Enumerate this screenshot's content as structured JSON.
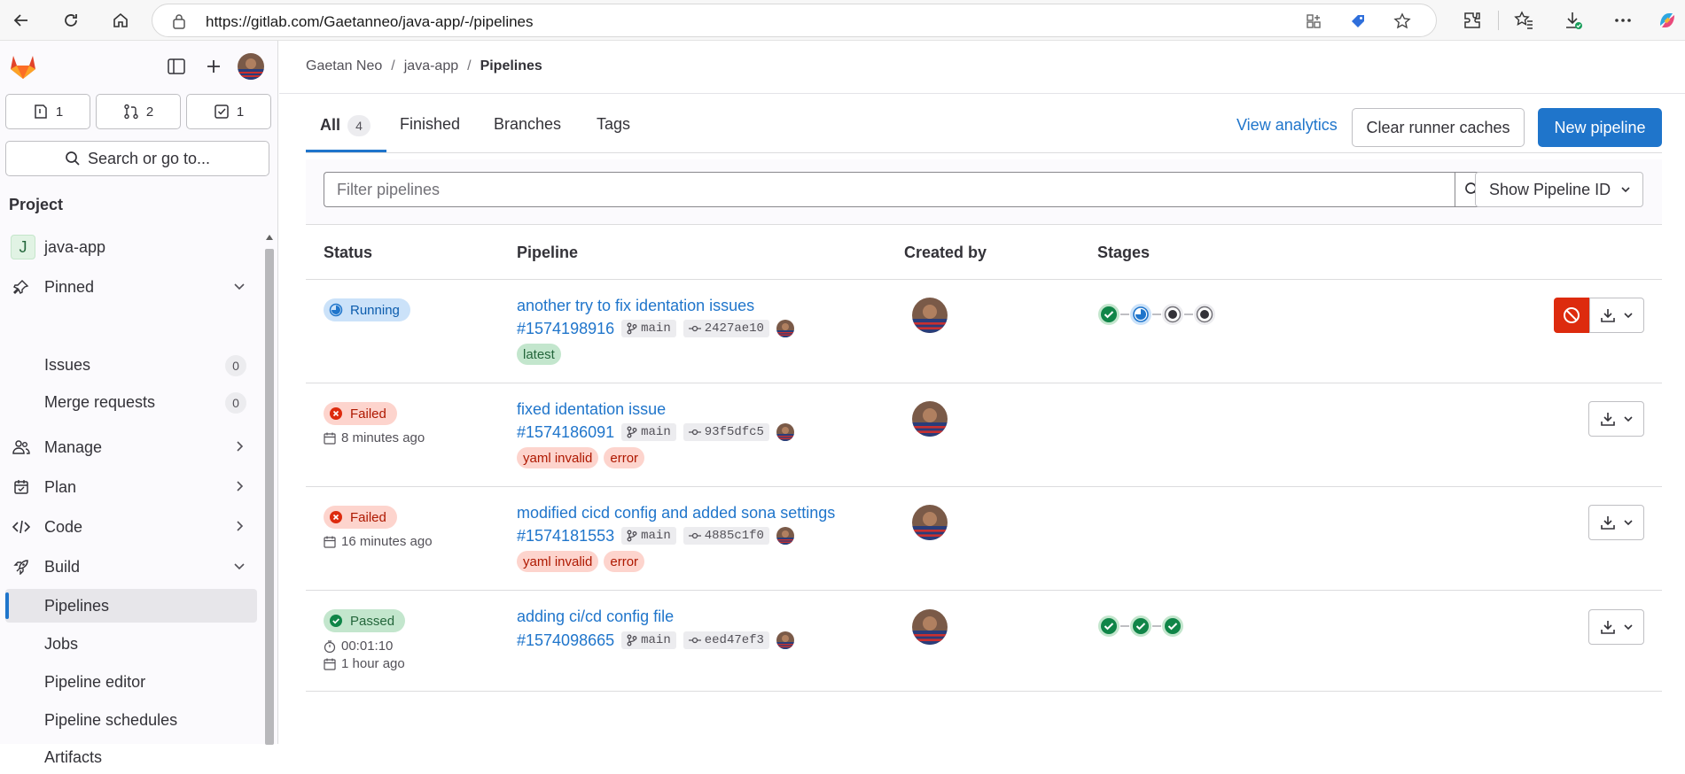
{
  "browser": {
    "url": "https://gitlab.com/Gaetanneo/java-app/-/pipelines"
  },
  "sidebar": {
    "counts": {
      "issues": "1",
      "merge_requests": "2",
      "todos": "1"
    },
    "search_label": "Search or go to...",
    "section_title": "Project",
    "project_letter": "J",
    "project_name": "java-app",
    "pinned": "Pinned",
    "issues": "Issues",
    "issues_count": "0",
    "merge_requests": "Merge requests",
    "merge_requests_count": "0",
    "manage": "Manage",
    "plan": "Plan",
    "code": "Code",
    "build": "Build",
    "pipelines": "Pipelines",
    "jobs": "Jobs",
    "pipeline_editor": "Pipeline editor",
    "pipeline_schedules": "Pipeline schedules",
    "artifacts": "Artifacts"
  },
  "breadcrumb": {
    "owner": "Gaetan Neo",
    "project": "java-app",
    "current": "Pipelines",
    "separator": "/"
  },
  "tabs": {
    "all": "All",
    "all_count": "4",
    "finished": "Finished",
    "branches": "Branches",
    "tags": "Tags"
  },
  "actions": {
    "view_analytics": "View analytics",
    "clear_caches": "Clear runner caches",
    "new_pipeline": "New pipeline"
  },
  "filter": {
    "placeholder": "Filter pipelines",
    "show_id": "Show Pipeline ID"
  },
  "table": {
    "headers": {
      "status": "Status",
      "pipeline": "Pipeline",
      "created_by": "Created by",
      "stages": "Stages"
    }
  },
  "pipelines": [
    {
      "status": "Running",
      "title": "another try to fix identation issues",
      "id": "#1574198916",
      "ref": "main",
      "sha": "2427ae10",
      "tags": [
        "latest"
      ],
      "stages": [
        "success",
        "running",
        "created",
        "created"
      ]
    },
    {
      "status": "Failed",
      "time_ago": "8 minutes ago",
      "title": "fixed identation issue",
      "id": "#1574186091",
      "ref": "main",
      "sha": "93f5dfc5",
      "tags": [
        "yaml invalid",
        "error"
      ],
      "stages": []
    },
    {
      "status": "Failed",
      "time_ago": "16 minutes ago",
      "title": "modified cicd config and added sona settings",
      "id": "#1574181553",
      "ref": "main",
      "sha": "4885c1f0",
      "tags": [
        "yaml invalid",
        "error"
      ],
      "stages": []
    },
    {
      "status": "Passed",
      "duration": "00:01:10",
      "time_ago": "1 hour ago",
      "title": "adding ci/cd config file",
      "id": "#1574098665",
      "ref": "main",
      "sha": "eed47ef3",
      "tags": [],
      "stages": [
        "success",
        "success",
        "success"
      ]
    }
  ],
  "colors": {
    "accent": "#1f75cb",
    "running": "#1f75cb",
    "failed": "#dd2b0e",
    "passed": "#108548"
  }
}
